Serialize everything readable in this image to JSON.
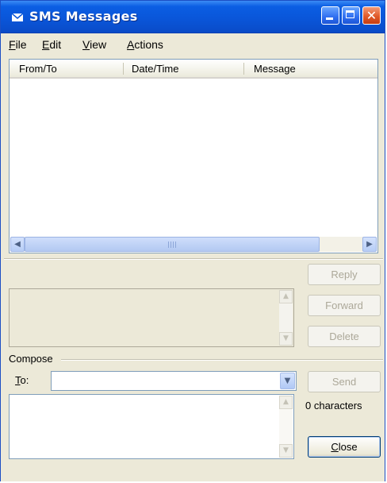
{
  "window": {
    "title": "SMS Messages",
    "icon": "envelope-icon",
    "controls": {
      "minimize": "minimize-icon",
      "maximize": "maximize-icon",
      "close": "close-icon",
      "close_glyph": "✕"
    }
  },
  "menu": [
    {
      "accel": "F",
      "rest": "ile"
    },
    {
      "accel": "E",
      "rest": "dit"
    },
    {
      "accel": "V",
      "rest": "iew"
    },
    {
      "accel": "A",
      "rest": "ctions"
    }
  ],
  "list": {
    "columns": [
      "From/To",
      "Date/Time",
      "Message"
    ],
    "rows": []
  },
  "buttons": {
    "reply": {
      "label": "Reply",
      "enabled": false
    },
    "forward": {
      "label": "Forward",
      "enabled": false
    },
    "delete": {
      "label": "Delete",
      "enabled": false
    },
    "send": {
      "label": "Send",
      "enabled": false
    },
    "close": {
      "label": "Close",
      "enabled": true
    }
  },
  "compose": {
    "group_label": "Compose",
    "to_accel": "T",
    "to_rest": "o:",
    "to_value": "",
    "message_value": "",
    "char_count": "0 characters"
  },
  "colors": {
    "titlebar": "#0a55d8",
    "window_bg": "#ece9d8",
    "close_button": "#e05a2a"
  }
}
